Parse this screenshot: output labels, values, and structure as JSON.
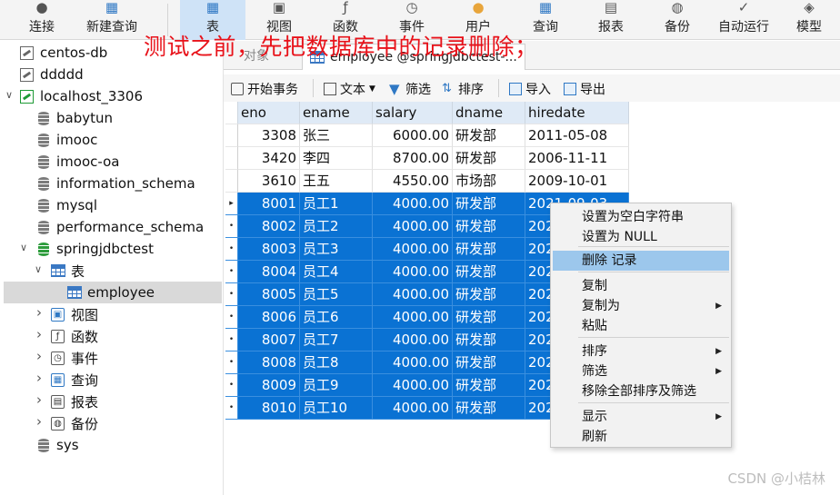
{
  "toolbar": {
    "items": [
      {
        "label": "连接",
        "icon": "plug-icon"
      },
      {
        "label": "新建查询",
        "icon": "new-query-icon"
      },
      {
        "label": "表",
        "icon": "table-icon"
      },
      {
        "label": "视图",
        "icon": "view-icon"
      },
      {
        "label": "函数",
        "icon": "function-icon"
      },
      {
        "label": "事件",
        "icon": "event-icon"
      },
      {
        "label": "用户",
        "icon": "user-icon"
      },
      {
        "label": "查询",
        "icon": "query-icon"
      },
      {
        "label": "报表",
        "icon": "report-icon"
      },
      {
        "label": "备份",
        "icon": "backup-icon"
      },
      {
        "label": "自动运行",
        "icon": "auto-run-icon"
      },
      {
        "label": "模型",
        "icon": "model-icon"
      }
    ],
    "active": "表"
  },
  "annotation": "测试之前，先把数据库中的记录删除；",
  "nav": {
    "items": [
      {
        "label": "centos-db",
        "type": "connection"
      },
      {
        "label": "ddddd",
        "type": "connection"
      },
      {
        "label": "localhost_3306",
        "type": "connection-open"
      },
      {
        "label": "babytun",
        "type": "database"
      },
      {
        "label": "imooc",
        "type": "database"
      },
      {
        "label": "imooc-oa",
        "type": "database"
      },
      {
        "label": "information_schema",
        "type": "database"
      },
      {
        "label": "mysql",
        "type": "database"
      },
      {
        "label": "performance_schema",
        "type": "database"
      },
      {
        "label": "springjdbctest",
        "type": "database-open"
      },
      {
        "label": "表",
        "type": "tables-folder"
      },
      {
        "label": "employee",
        "type": "table"
      },
      {
        "label": "视图",
        "type": "views-folder"
      },
      {
        "label": "函数",
        "type": "functions-folder"
      },
      {
        "label": "事件",
        "type": "events-folder"
      },
      {
        "label": "查询",
        "type": "queries-folder"
      },
      {
        "label": "报表",
        "type": "reports-folder"
      },
      {
        "label": "备份",
        "type": "backups-folder"
      },
      {
        "label": "sys",
        "type": "database"
      }
    ],
    "selected": "employee"
  },
  "tabs": {
    "objects_label": "对象",
    "active_tab": "employee @springjdbctest-..."
  },
  "gridbar": {
    "begin_txn": "开始事务",
    "text": "文本",
    "filter": "筛选",
    "sort": "排序",
    "import": "导入",
    "export": "导出"
  },
  "grid": {
    "columns": [
      "eno",
      "ename",
      "salary",
      "dname",
      "hiredate"
    ],
    "rows": [
      [
        "3308",
        "张三",
        "6000.00",
        "研发部",
        "2011-05-08"
      ],
      [
        "3420",
        "李四",
        "8700.00",
        "研发部",
        "2006-11-11"
      ],
      [
        "3610",
        "王五",
        "4550.00",
        "市场部",
        "2009-10-01"
      ],
      [
        "8001",
        "员工1",
        "4000.00",
        "研发部",
        "2021-09-03"
      ],
      [
        "8002",
        "员工2",
        "4000.00",
        "研发部",
        "202"
      ],
      [
        "8003",
        "员工3",
        "4000.00",
        "研发部",
        "202"
      ],
      [
        "8004",
        "员工4",
        "4000.00",
        "研发部",
        "202"
      ],
      [
        "8005",
        "员工5",
        "4000.00",
        "研发部",
        "202"
      ],
      [
        "8006",
        "员工6",
        "4000.00",
        "研发部",
        "202"
      ],
      [
        "8007",
        "员工7",
        "4000.00",
        "研发部",
        "202"
      ],
      [
        "8008",
        "员工8",
        "4000.00",
        "研发部",
        "202"
      ],
      [
        "8009",
        "员工9",
        "4000.00",
        "研发部",
        "202"
      ],
      [
        "8010",
        "员工10",
        "4000.00",
        "研发部",
        "202"
      ]
    ],
    "selected_from": 3
  },
  "context_menu": {
    "items": [
      {
        "label": "设置为空白字符串",
        "submenu": false
      },
      {
        "label": "设置为 NULL",
        "submenu": false
      },
      {
        "label": "删除 记录",
        "submenu": false,
        "highlight": true
      },
      {
        "label": "复制",
        "submenu": false
      },
      {
        "label": "复制为",
        "submenu": true
      },
      {
        "label": "粘贴",
        "submenu": false
      },
      {
        "label": "排序",
        "submenu": true
      },
      {
        "label": "筛选",
        "submenu": true
      },
      {
        "label": "移除全部排序及筛选",
        "submenu": false
      },
      {
        "label": "显示",
        "submenu": true
      },
      {
        "label": "刷新",
        "submenu": false
      }
    ]
  },
  "watermark": "CSDN @小桔林",
  "colors": {
    "selection": "#0a72d3",
    "annotation": "#e8121a",
    "menu_highlight": "#9cc7ec"
  }
}
